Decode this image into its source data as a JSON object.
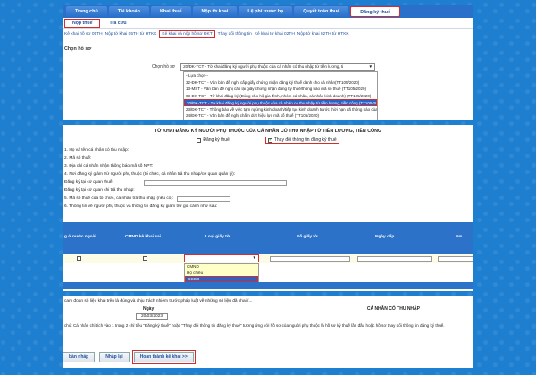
{
  "nav": [
    "Trang chủ",
    "Tài khoản",
    "Khai thuế",
    "Nộp tờ khai",
    "Lệ phí trước bạ",
    "Quyết toán thuế",
    "Đăng ký thuế"
  ],
  "subnav": [
    "Nộp thuế",
    "Tra cứu"
  ],
  "links": [
    "Kê khai hồ sơ 05TH",
    "Nộp tờ khai 05TH từ HTKK",
    "Kê khai và nộp hồ sơ ĐKT",
    "Thay đổi thông tin",
    "Kê khai tờ khai 02TH",
    "Nộp tờ khai 02TH từ HTKK"
  ],
  "section_title": "Chọn hồ sơ",
  "form": {
    "label": "Chọn hồ sơ",
    "selected": "20/ĐK-TCT - Tờ khai đăng ký người phụ thuộc của cá nhân có thu nhập từ tiền lương, ti",
    "caret": "▼",
    "options": [
      "--Lựa chọn--",
      "32-ĐK-TCT - Văn bản đề nghị cấp giấy chứng nhận đăng ký thuế dành cho cá nhân(TT105/2020)",
      "13-MST - Văn bản đề nghị cấp lại giấy chứng nhận đăng ký thuế/thông báo mã số thuế (TT105/2020)",
      "03-ĐK-TCT - Tờ khai đăng ký (Dùng cho hộ gia đình, nhóm cá nhân, cá nhân kinh doanh) (TT105/2020)",
      "20/ĐK-TCT - Tờ khai đăng ký người phụ thuộc của cá nhân có thu nhập từ tiền lương, tiền công (TT105/2020)",
      "23/ĐK-TCT - Thông báo về việc tạm ngừng kinh doanh/tiếp tục kinh doanh trước thời hạn đã thông báo của người nộp thuế (TT105/2020)",
      "24/ĐK-TCT - Văn bản đề nghị chấm dứt hiệu lực mã số thuế (TT105/2020)"
    ]
  },
  "form2": {
    "title": "TỜ KHAI ĐĂNG KÝ NGƯỜI PHỤ THUỘC CỦA CÁ NHÂN CÓ THU NHẬP TỪ TIỀN LƯƠNG, TIỀN CÔNG",
    "chk1": "Đăng ký thuế",
    "chk2": "Thay đổi thông tin đăng ký thuế",
    "f1": "1. Họ và tên cá nhân có thu nhập:",
    "f2": "2. Mã số thuế:",
    "f3": "3. Địa chỉ cá nhân nhận thông báo mã số NPT:",
    "f4": "4. Nơi đăng ký giảm trừ người phụ thuộc (tổ chức, cá nhân trả thu nhập/cơ quan quản lý):",
    "f4a": "Đăng ký tại cơ quan thuế:",
    "f4b": "Đăng ký tại cơ quan chi trả thu nhập:",
    "f5": "5. Mã số thuế của tổ chức, cá nhân trả thu nhập (nếu có):",
    "f6": "6. Thông tin về người phụ thuộc và thông tin đăng ký giảm trừ gia cảnh như sau:",
    "cols": [
      "g ở nước ngoài",
      "CMND kê khai sai",
      "Loại giấy tờ",
      "Số giấy tờ",
      "Ngày cấp",
      "Nơ"
    ],
    "row_caret": "▼",
    "doc_options": [
      "CMND",
      "Hộ chiếu",
      "CCCD"
    ]
  },
  "confirm": {
    "text": "cam đoan số liệu khai trên là đúng và chịu trách nhiệm trước pháp luật về những số liệu đã khai./...",
    "date_label": "Ngày",
    "taxpayer_label": "CÁ NHÂN CÓ THU NHẬP",
    "date": "20/03/2023",
    "note": "chú: Cá nhân chỉ tích vào 1 trong 2 chỉ tiêu \"Đăng ký thuế\" hoặc \"Thay đổi thông tin đăng ký thuế\" tương ứng với hồ sơ của người phụ thuộc là hồ sơ ký thuế lần đầu hoặc hồ sơ thay đổi thông tin đăng ký thuế.",
    "buttons": [
      "bàn nháp",
      "Nhập lại",
      "Hoàn thành kê khai >>"
    ]
  }
}
